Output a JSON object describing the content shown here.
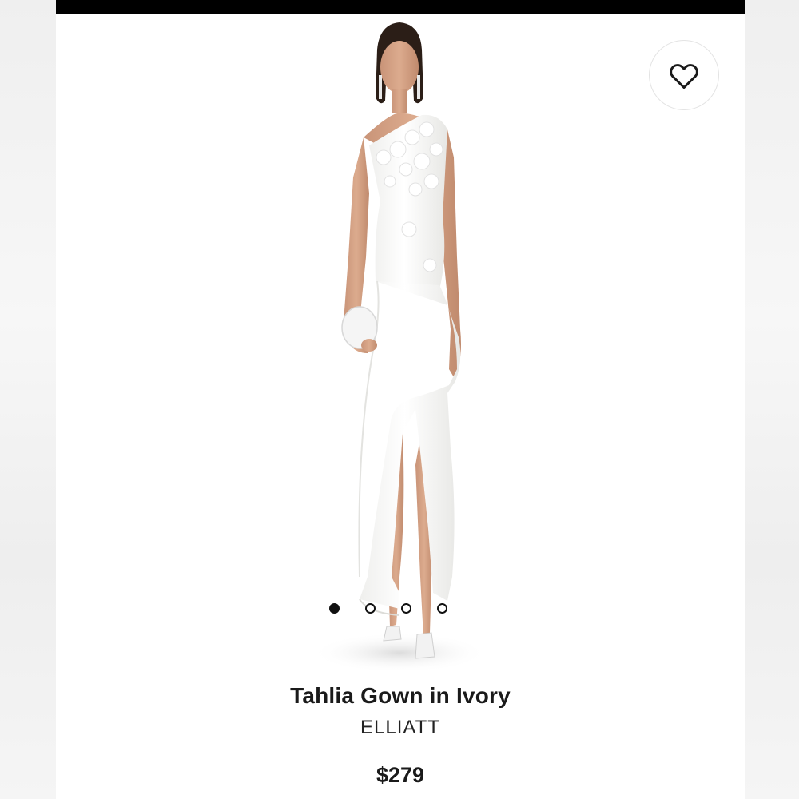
{
  "product": {
    "title": "Tahlia Gown in Ivory",
    "brand": "ELLIATT",
    "price": "$279",
    "image_alt": "Model wearing ivory one-shoulder asymmetric gown"
  },
  "favorite": {
    "icon": "heart-outline-icon"
  },
  "carousel": {
    "total_slides": 4,
    "active_index": 0
  },
  "colors": {
    "top_bar": "#000000",
    "text": "#1a1a1a",
    "background": "#ffffff"
  }
}
